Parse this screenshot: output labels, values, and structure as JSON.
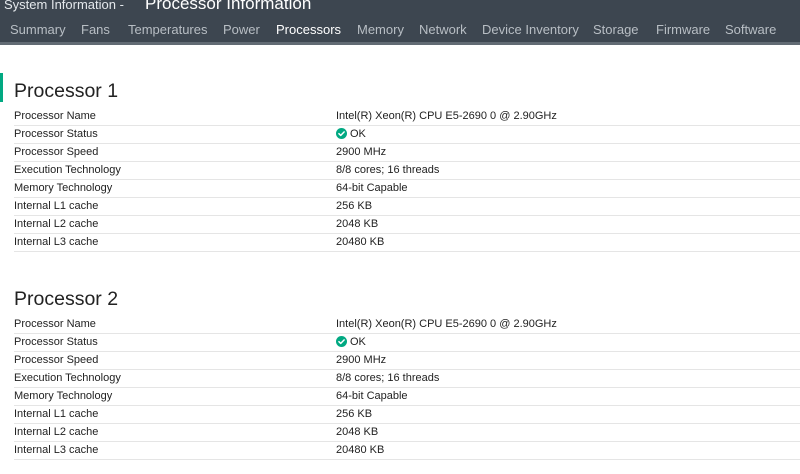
{
  "window": {
    "title_prefix": "System Information - ",
    "title": "Processor Information"
  },
  "tabs": [
    {
      "label": "Summary"
    },
    {
      "label": "Fans"
    },
    {
      "label": "Temperatures"
    },
    {
      "label": "Power"
    },
    {
      "label": "Processors",
      "active": true
    },
    {
      "label": "Memory"
    },
    {
      "label": "Network"
    },
    {
      "label": "Device Inventory"
    },
    {
      "label": "Storage"
    },
    {
      "label": "Firmware"
    },
    {
      "label": "Software"
    }
  ],
  "colors": {
    "header_bg": "#3d4650",
    "accent": "#01a982",
    "ok_icon": "#01a982"
  },
  "processors": [
    {
      "heading": "Processor 1",
      "rows": [
        {
          "label": "Processor Name",
          "value": "Intel(R) Xeon(R) CPU E5-2690 0 @ 2.90GHz"
        },
        {
          "label": "Processor Status",
          "value": "OK",
          "icon": "check-circle-icon"
        },
        {
          "label": "Processor Speed",
          "value": "2900 MHz"
        },
        {
          "label": "Execution Technology",
          "value": "8/8 cores; 16 threads"
        },
        {
          "label": "Memory Technology",
          "value": "64-bit Capable"
        },
        {
          "label": "Internal L1 cache",
          "value": "256 KB"
        },
        {
          "label": "Internal L2 cache",
          "value": "2048 KB"
        },
        {
          "label": "Internal L3 cache",
          "value": "20480 KB"
        }
      ]
    },
    {
      "heading": "Processor 2",
      "rows": [
        {
          "label": "Processor Name",
          "value": "Intel(R) Xeon(R) CPU E5-2690 0 @ 2.90GHz"
        },
        {
          "label": "Processor Status",
          "value": "OK",
          "icon": "check-circle-icon"
        },
        {
          "label": "Processor Speed",
          "value": "2900 MHz"
        },
        {
          "label": "Execution Technology",
          "value": "8/8 cores; 16 threads"
        },
        {
          "label": "Memory Technology",
          "value": "64-bit Capable"
        },
        {
          "label": "Internal L1 cache",
          "value": "256 KB"
        },
        {
          "label": "Internal L2 cache",
          "value": "2048 KB"
        },
        {
          "label": "Internal L3 cache",
          "value": "20480 KB"
        }
      ]
    }
  ]
}
